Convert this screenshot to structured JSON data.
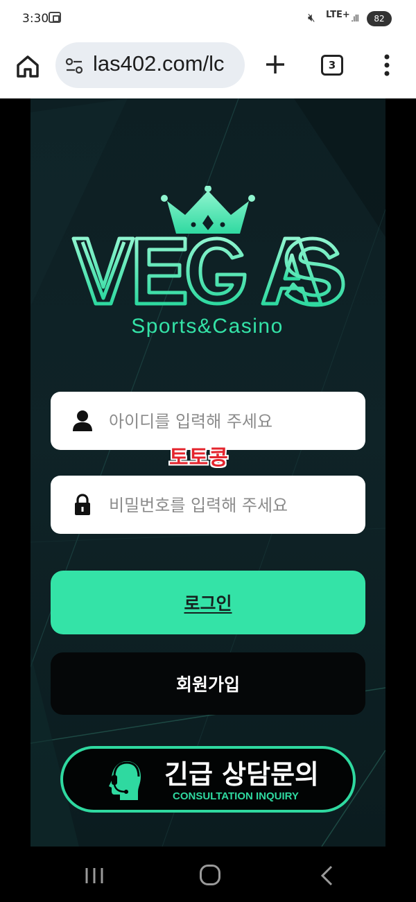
{
  "status_bar": {
    "time": "3:30",
    "network": "LTE+",
    "battery": "82",
    "icons": [
      "screen-capture-icon",
      "mute-icon",
      "signal-icon",
      "battery-icon"
    ]
  },
  "browser": {
    "url": "las402.com/lc",
    "tab_count": "3",
    "icons": [
      "home-icon",
      "site-settings-icon",
      "plus-icon",
      "tabs-icon",
      "more-vert-icon"
    ]
  },
  "logo": {
    "brand": "VEGAS",
    "tagline": "Sports&Casino",
    "colors": {
      "mint": "#34e3a7"
    }
  },
  "login_form": {
    "id_placeholder": "아이디를 입력해 주세요",
    "password_placeholder": "비밀번호를 입력해 주세요",
    "login_label": "로그인",
    "signup_label": "회원가입"
  },
  "watermark": "토토콩",
  "consult": {
    "title": "긴급 상담문의",
    "subtitle": "CONSULTATION INQUIRY",
    "icon": "headset-agent-icon"
  },
  "colors": {
    "accent": "#34e3a7",
    "background": "#0d1f23",
    "watermark": "#e4242d"
  }
}
